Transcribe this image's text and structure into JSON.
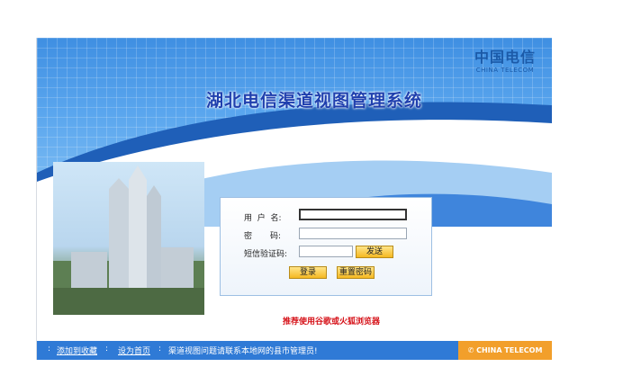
{
  "header": {
    "logo_mark": "中国电信",
    "logo_sub": "CHINA TELECOM",
    "title": "湖北电信渠道视图管理系统"
  },
  "login": {
    "username_label": "用  户  名:",
    "username_value": "",
    "password_label": "密       码:",
    "password_value": "",
    "sms_label": "短信验证码:",
    "sms_value": "",
    "send_button": "发送",
    "login_button": "登录",
    "reset_button": "重置密码"
  },
  "notice": "推荐使用谷歌或火狐浏览器",
  "footer": {
    "favorite_link": "添加到收藏",
    "homepage_link": "设为首页",
    "contact_text": "渠道视图问题请联系本地网的县市管理员!",
    "brand": "CHINA TELECOM"
  },
  "colors": {
    "banner_blue": "#3f8fe2",
    "title_blue": "#1f3fae",
    "footer_blue": "#2f7ad6",
    "brand_orange": "#f29f2b",
    "notice_red": "#d6141b",
    "button_yellow": "#f5b821"
  }
}
